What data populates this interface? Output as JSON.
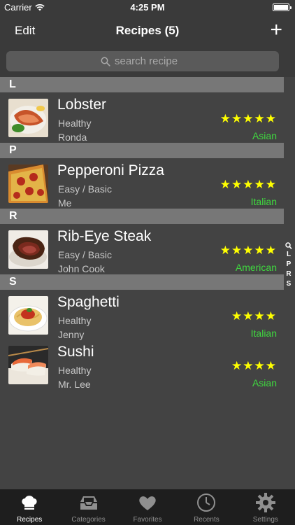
{
  "status_bar": {
    "carrier": "Carrier",
    "time": "4:25 PM"
  },
  "nav": {
    "edit_label": "Edit",
    "title": "Recipes (5)",
    "add_label": "+"
  },
  "search": {
    "placeholder": "search recipe"
  },
  "sections": [
    {
      "letter": "L",
      "recipes": [
        {
          "name": "Lobster",
          "difficulty": "Healthy",
          "author": "Ronda",
          "stars": 5,
          "cuisine": "Asian",
          "image": "lobster-photo"
        }
      ]
    },
    {
      "letter": "P",
      "recipes": [
        {
          "name": "Pepperoni Pizza",
          "difficulty": "Easy / Basic",
          "author": "Me",
          "stars": 5,
          "cuisine": "Italian",
          "image": "pizza-photo"
        }
      ]
    },
    {
      "letter": "R",
      "recipes": [
        {
          "name": "Rib-Eye Steak",
          "difficulty": "Easy / Basic",
          "author": "John Cook",
          "stars": 5,
          "cuisine": "American",
          "image": "steak-photo"
        }
      ]
    },
    {
      "letter": "S",
      "recipes": [
        {
          "name": "Spaghetti",
          "difficulty": "Healthy",
          "author": "Jenny",
          "stars": 4,
          "cuisine": "Italian",
          "image": "spaghetti-photo"
        },
        {
          "name": "Sushi",
          "difficulty": "Healthy",
          "author": "Mr. Lee",
          "stars": 4,
          "cuisine": "Asian",
          "image": "sushi-photo"
        }
      ]
    }
  ],
  "index_letters": [
    "L",
    "P",
    "R",
    "S"
  ],
  "tabs": [
    {
      "label": "Recipes",
      "icon": "chef-hat-icon",
      "active": true
    },
    {
      "label": "Categories",
      "icon": "tray-icon",
      "active": false
    },
    {
      "label": "Favorites",
      "icon": "heart-icon",
      "active": false
    },
    {
      "label": "Recents",
      "icon": "clock-icon",
      "active": false
    },
    {
      "label": "Settings",
      "icon": "gear-icon",
      "active": false
    }
  ],
  "colors": {
    "stars": "#ffff00",
    "cuisine": "#3fd93f",
    "section_header": "#777777",
    "background": "#434343"
  }
}
